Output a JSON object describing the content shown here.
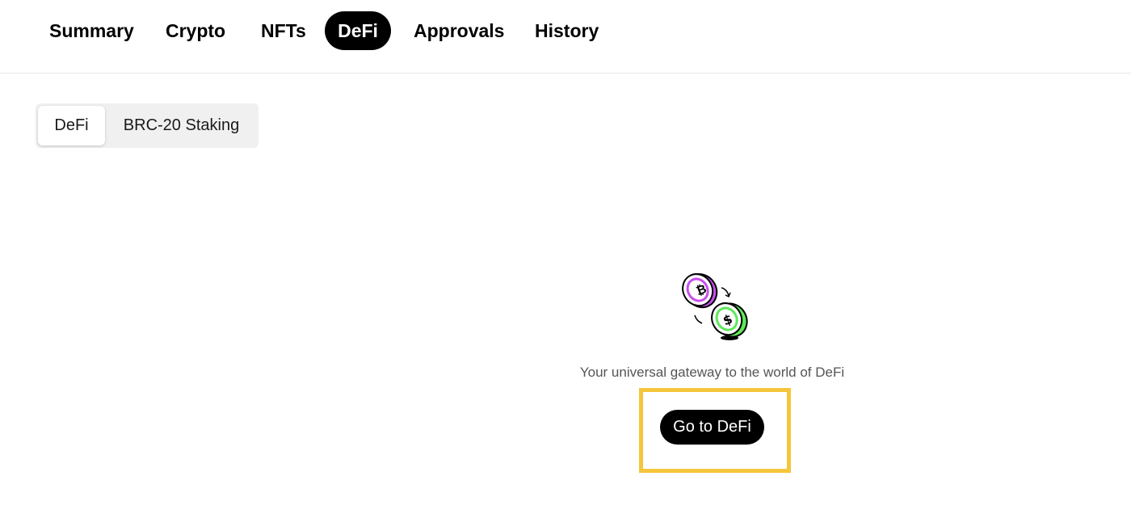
{
  "nav": {
    "tabs": [
      {
        "label": "Summary",
        "active": false
      },
      {
        "label": "Crypto",
        "active": false
      },
      {
        "label": "NFTs",
        "active": false
      },
      {
        "label": "DeFi",
        "active": true
      },
      {
        "label": "Approvals",
        "active": false
      },
      {
        "label": "History",
        "active": false
      }
    ]
  },
  "segment": {
    "items": [
      {
        "label": "DeFi",
        "active": true
      },
      {
        "label": "BRC-20 Staking",
        "active": false
      }
    ]
  },
  "empty_state": {
    "illustration": "coin-swap-icon",
    "tagline": "Your universal gateway to the world of DeFi",
    "button_label": "Go to DeFi"
  },
  "colors": {
    "accent_black": "#000000",
    "highlight_yellow": "#f5c63c",
    "coin_purple": "#c94df0",
    "coin_green": "#5ee85a"
  }
}
